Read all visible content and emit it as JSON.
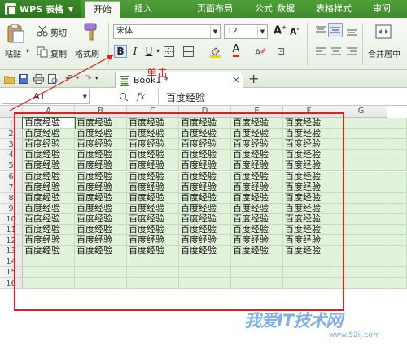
{
  "app": {
    "name": "WPS 表格"
  },
  "menu": {
    "tabs": [
      {
        "label": "开始",
        "active": true
      },
      {
        "label": "插入"
      },
      {
        "label": "页面布局"
      },
      {
        "label": "公式"
      },
      {
        "label": "数据"
      },
      {
        "label": "表格样式"
      },
      {
        "label": "审阅"
      }
    ]
  },
  "ribbon": {
    "cut_label": "剪切",
    "paste_label": "粘贴",
    "copy_label": "复制",
    "format_painter_label": "格式刷",
    "font_name": "宋体",
    "font_size": "12",
    "bold_label": "B",
    "italic_label": "I",
    "underline_label": "U",
    "merge_center_label": "合并居中"
  },
  "document": {
    "tab_title": "Book1 *"
  },
  "formula_bar": {
    "cell_ref": "A1",
    "fx_label": "fx",
    "content": "百度经验"
  },
  "sheet": {
    "columns": [
      "A",
      "B",
      "C",
      "D",
      "E",
      "F",
      "G"
    ],
    "rows": [
      "1",
      "2",
      "3",
      "4",
      "5",
      "6",
      "7",
      "8",
      "9",
      "10",
      "11",
      "12",
      "13",
      "14",
      "15",
      "16"
    ],
    "cell_text": "百度经验",
    "filled_rows": 13,
    "filled_cols": 6
  },
  "annotation": {
    "callout": "单击"
  },
  "watermark": {
    "text": "我爱IT技术网",
    "url": "www.52ij.com"
  },
  "colors": {
    "brand": "#3f8a2d",
    "grid": "#e3f2dc",
    "annotation": "#e02020"
  }
}
